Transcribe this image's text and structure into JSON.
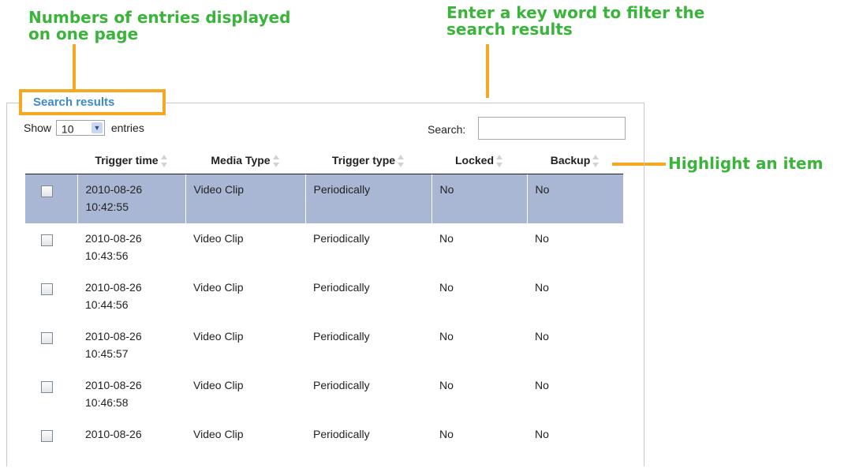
{
  "callouts": {
    "entries_line1": "Numbers of entries displayed",
    "entries_line2": "on one page",
    "search_line1": "Enter a key word to filter the",
    "search_line2": "search results",
    "highlight": "Highlight an item"
  },
  "panel": {
    "legend": "Search results",
    "show_label": "Show",
    "entries_value": "10",
    "entries_label": "entries",
    "search_label": "Search:",
    "search_value": ""
  },
  "table": {
    "columns": [
      "Trigger time",
      "Media Type",
      "Trigger type",
      "Locked",
      "Backup"
    ],
    "rows": [
      {
        "date": "2010-08-26",
        "time": "10:42:55",
        "media": "Video Clip",
        "trigger": "Periodically",
        "locked": "No",
        "backup": "No",
        "highlighted": true
      },
      {
        "date": "2010-08-26",
        "time": "10:43:56",
        "media": "Video Clip",
        "trigger": "Periodically",
        "locked": "No",
        "backup": "No",
        "highlighted": false
      },
      {
        "date": "2010-08-26",
        "time": "10:44:56",
        "media": "Video Clip",
        "trigger": "Periodically",
        "locked": "No",
        "backup": "No",
        "highlighted": false
      },
      {
        "date": "2010-08-26",
        "time": "10:45:57",
        "media": "Video Clip",
        "trigger": "Periodically",
        "locked": "No",
        "backup": "No",
        "highlighted": false
      },
      {
        "date": "2010-08-26",
        "time": "10:46:58",
        "media": "Video Clip",
        "trigger": "Periodically",
        "locked": "No",
        "backup": "No",
        "highlighted": false
      },
      {
        "date": "2010-08-26",
        "time": "",
        "media": "Video Clip",
        "trigger": "Periodically",
        "locked": "No",
        "backup": "No",
        "highlighted": false
      }
    ]
  },
  "colors": {
    "callout_text": "#3ab43a",
    "callout_marker": "#f7a823",
    "legend_text": "#3c8ac8",
    "highlight_row": "#a9b7d4"
  },
  "icons": {
    "sort": "sort-arrows-icon",
    "dropdown": "chevron-down-icon",
    "checkbox": "checkbox-icon"
  }
}
